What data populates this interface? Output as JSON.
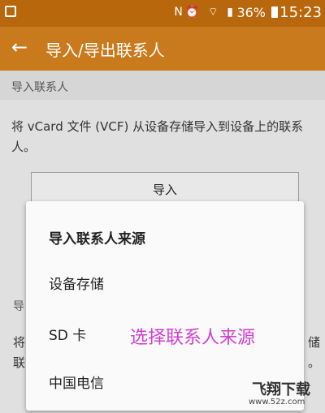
{
  "status_bar": {
    "battery": "36%",
    "time": "15:23"
  },
  "app_bar": {
    "title": "导入/导出联系人"
  },
  "import_section": {
    "header": "导入联系人",
    "description": "将 vCard 文件 (VCF) 从设备存储导入到设备上的联系人。",
    "button_label": "导入"
  },
  "background_fragments": {
    "left_1": "导",
    "left_2": "将",
    "left_3": "联",
    "right_1": "储",
    "right_2": "。"
  },
  "dialog": {
    "title": "导入联系人来源",
    "options": [
      "设备存储",
      "SD 卡",
      "中国电信"
    ]
  },
  "annotation": "选择联系人来源",
  "watermark": {
    "name": "飞翔下载",
    "url": "www.52z.com"
  },
  "colors": {
    "status_bar": "#b8670c",
    "app_bar": "#c97a1c",
    "annotation": "#d03fd0"
  }
}
